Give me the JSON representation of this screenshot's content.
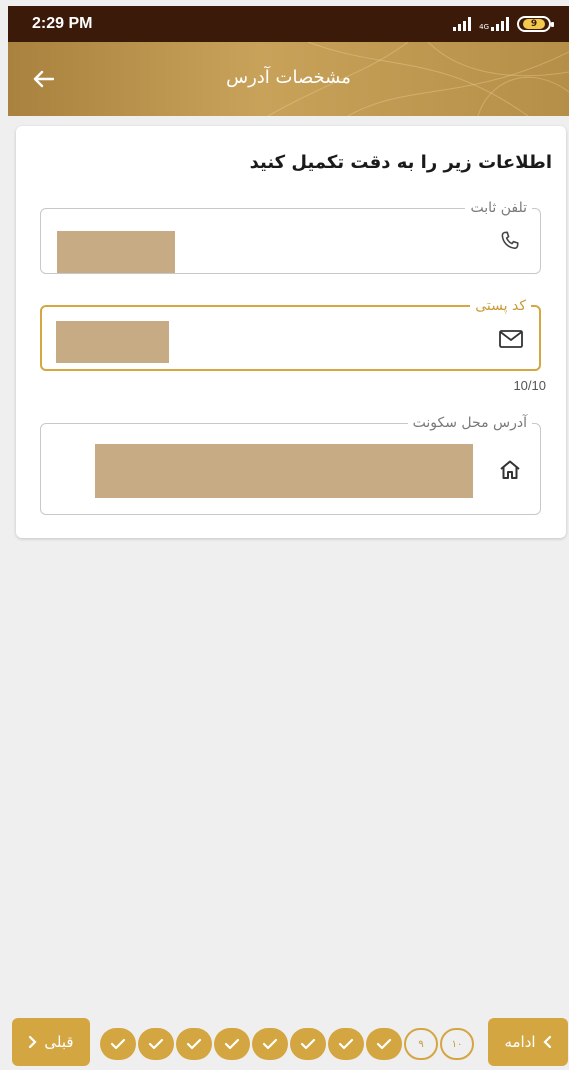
{
  "status_bar": {
    "time": "2:29 PM",
    "network_label": "4G",
    "battery_level": "9",
    "icons": [
      "signal-icon",
      "signal-4g-icon",
      "battery-icon"
    ]
  },
  "header": {
    "title": "مشخصات آدرس",
    "back_icon": "arrow-left-icon"
  },
  "form": {
    "instruction": "اطلاعات زیر را به دقت تکمیل کنید",
    "fields": [
      {
        "label": "تلفن ثابت",
        "value": "",
        "icon": "phone-icon",
        "state": "default"
      },
      {
        "label": "کد پستی",
        "value": "",
        "icon": "mail-icon",
        "state": "focused",
        "counter": "10/10"
      },
      {
        "label": "آدرس محل سکونت",
        "value": "",
        "icon": "home-icon",
        "state": "default"
      }
    ]
  },
  "footer": {
    "next_label": "ادامه",
    "prev_label": "قبلی",
    "steps": [
      {
        "state": "done"
      },
      {
        "state": "done"
      },
      {
        "state": "done"
      },
      {
        "state": "done"
      },
      {
        "state": "done"
      },
      {
        "state": "done"
      },
      {
        "state": "done"
      },
      {
        "state": "done"
      },
      {
        "state": "pending",
        "label": "۹"
      },
      {
        "state": "pending",
        "label": "۱۰"
      }
    ]
  },
  "colors": {
    "status_bar": "#3b1a09",
    "accent": "#d4a642",
    "header": "#b58f47",
    "redacted": "#c6ab84",
    "background": "#efefef"
  }
}
